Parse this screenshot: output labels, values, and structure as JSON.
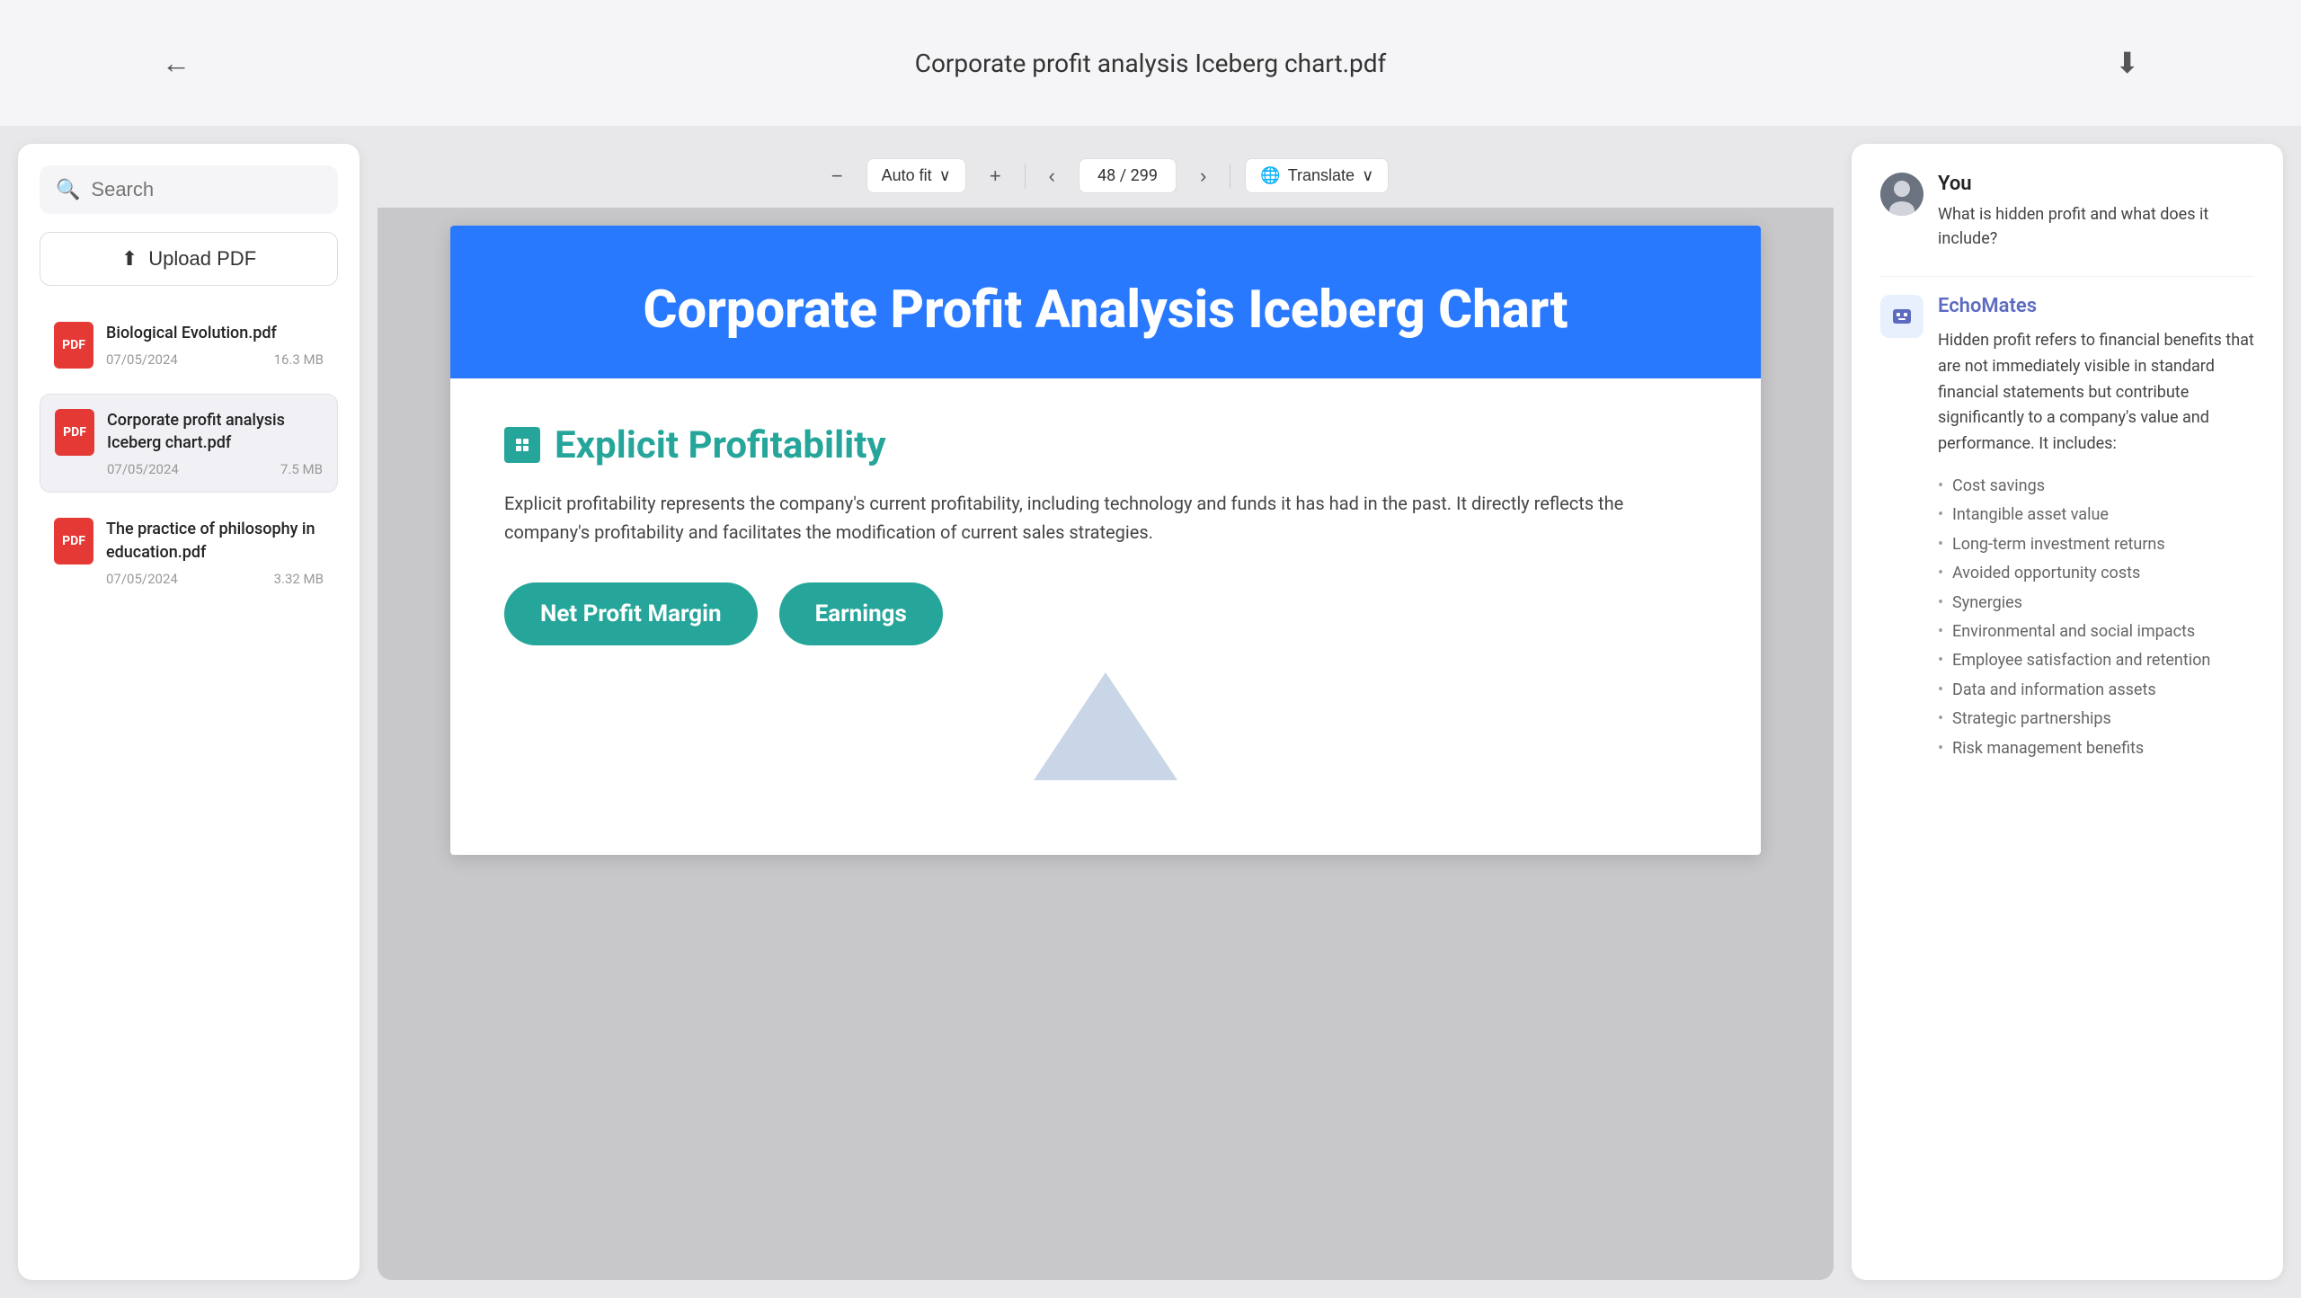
{
  "topBar": {
    "title": "Corporate profit analysis Iceberg chart.pdf",
    "backIcon": "←",
    "downloadIcon": "⬇"
  },
  "sidebar": {
    "searchPlaceholder": "Search",
    "uploadLabel": "Upload PDF",
    "files": [
      {
        "name": "Biological Evolution.pdf",
        "date": "07/05/2024",
        "size": "16.3 MB",
        "active": false
      },
      {
        "name": "Corporate profit analysis Iceberg chart.pdf",
        "date": "07/05/2024",
        "size": "7.5 MB",
        "active": true
      },
      {
        "name": "The practice of philosophy in education.pdf",
        "date": "07/05/2024",
        "size": "3.32 MB",
        "active": false
      }
    ]
  },
  "pdfViewer": {
    "zoomOutIcon": "−",
    "zoomInIcon": "+",
    "zoomFitLabel": "Auto fit",
    "prevIcon": "‹",
    "nextIcon": "›",
    "pageIndicator": "48 / 299",
    "translateIcon": "🌐",
    "translateLabel": "Translate",
    "content": {
      "mainTitle": "Corporate Profit Analysis Iceberg Chart",
      "sectionTitle": "Explicit Profitability",
      "sectionText": "Explicit profitability represents the company's current profitability, including technology and funds it has had in the past. It directly reflects the company's profitability and facilitates the modification of current sales strategies.",
      "pills": [
        "Net Profit Margin",
        "Earnings"
      ],
      "headerBg": "#2979ff",
      "tealColor": "#26a69a"
    }
  },
  "chat": {
    "youLabel": "You",
    "youQuestion": "What is hidden profit and what does it include?",
    "botName": "EchoMates",
    "botIntro": "Hidden profit refers to financial benefits that are not immediately visible in standard financial statements but contribute significantly to a company's value and performance. It includes:",
    "botList": [
      "Cost savings",
      "Intangible asset value",
      "Long-term investment returns",
      "Avoided opportunity costs",
      "Synergies",
      "Environmental and social impacts",
      "Employee satisfaction and retention",
      "Data and information assets",
      "Strategic partnerships",
      "Risk management benefits"
    ]
  }
}
